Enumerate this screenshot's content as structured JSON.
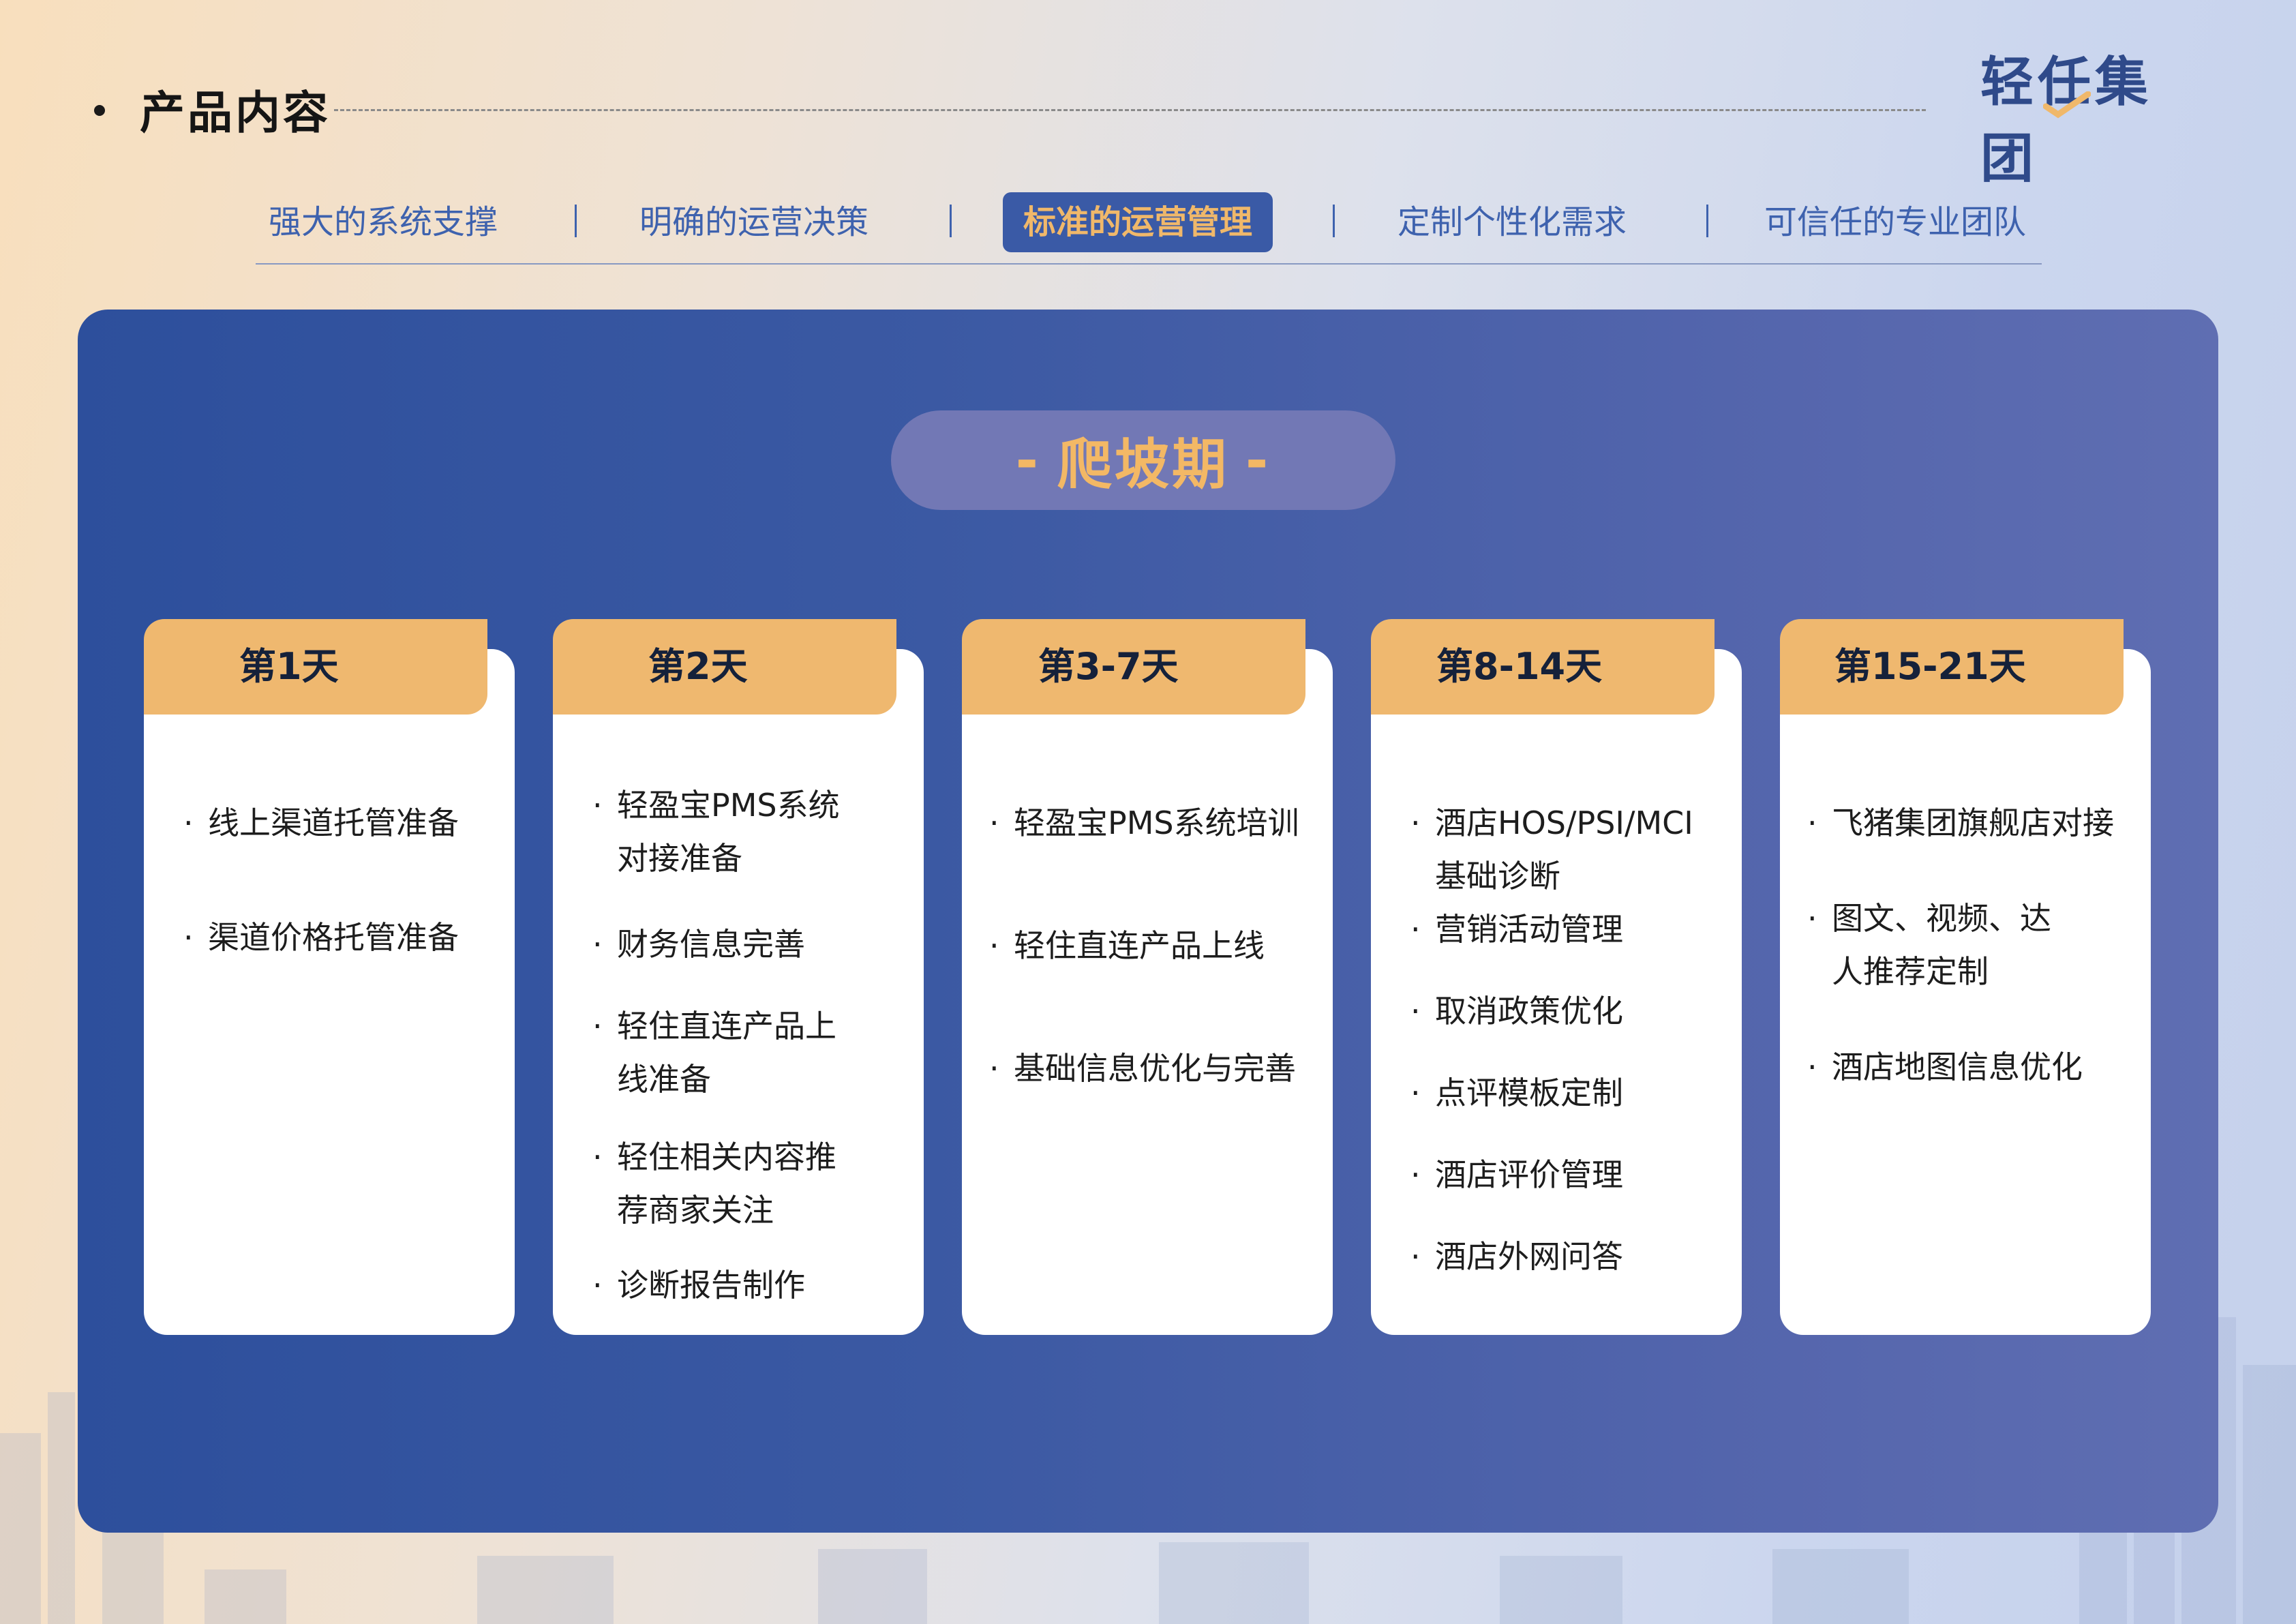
{
  "header": {
    "title": "产品内容",
    "logo": "轻任集团"
  },
  "tabs": [
    {
      "label": "强大的系统支撑",
      "active": false
    },
    {
      "label": "明确的运营决策",
      "active": false
    },
    {
      "label": "标准的运营管理",
      "active": true
    },
    {
      "label": "定制个性化需求",
      "active": false
    },
    {
      "label": "可信任的专业团队",
      "active": false
    }
  ],
  "phase": {
    "dash": "-",
    "title": "爬坡期"
  },
  "cards": [
    {
      "title": "第1天",
      "items": [
        "线上渠道托管准备",
        "渠道价格托管准备"
      ]
    },
    {
      "title": "第2天",
      "items": [
        "轻盈宝PMS系统对接准备",
        "财务信息完善",
        "轻住直连产品上线准备",
        "轻住相关内容推荐商家关注",
        "诊断报告制作"
      ]
    },
    {
      "title": "第3-7天",
      "items": [
        "轻盈宝PMS系统培训",
        "轻住直连产品上线",
        "基础信息优化与完善"
      ]
    },
    {
      "title": "第8-14天",
      "items": [
        "酒店HOS/PSI/MCI基础诊断",
        "营销活动管理",
        "取消政策优化",
        "点评模板定制",
        "酒店评价管理",
        "酒店外网问答"
      ]
    },
    {
      "title": "第15-21天",
      "items": [
        "飞猪集团旗舰店对接",
        "图文、视频、达人推荐定制",
        "酒店地图信息优化"
      ]
    }
  ],
  "bullet": "·",
  "colors": {
    "accent_orange": "#efb86f",
    "panel_blue": "#3b59a3",
    "tab_blue": "#3e62ae"
  }
}
